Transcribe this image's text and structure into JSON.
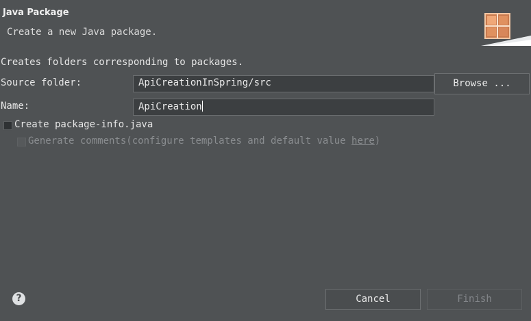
{
  "header": {
    "title": "Java Package",
    "subtitle": "Create a new Java package."
  },
  "description": "Creates folders corresponding to packages.",
  "form": {
    "source_folder_label": "Source folder:",
    "source_folder_value": "ApiCreationInSpring/src",
    "browse_label": "Browse ...",
    "name_label": "Name:",
    "name_value": "ApiCreation",
    "create_package_info_label": "Create package-info.java",
    "create_package_info_checked": false,
    "generate_comments_prefix": "Generate comments",
    "generate_comments_middle": "(configure templates and default value ",
    "generate_comments_link": "here",
    "generate_comments_suffix": ")",
    "generate_comments_checked": false,
    "generate_comments_enabled": false
  },
  "footer": {
    "help_icon": "help-icon",
    "cancel_label": "Cancel",
    "finish_label": "Finish",
    "finish_enabled": false
  },
  "colors": {
    "background": "#4f5254",
    "field_background": "#3c3f41",
    "text": "#e6e6e6",
    "disabled_text": "#8a8d90",
    "banner_icon": "#e8a070"
  }
}
